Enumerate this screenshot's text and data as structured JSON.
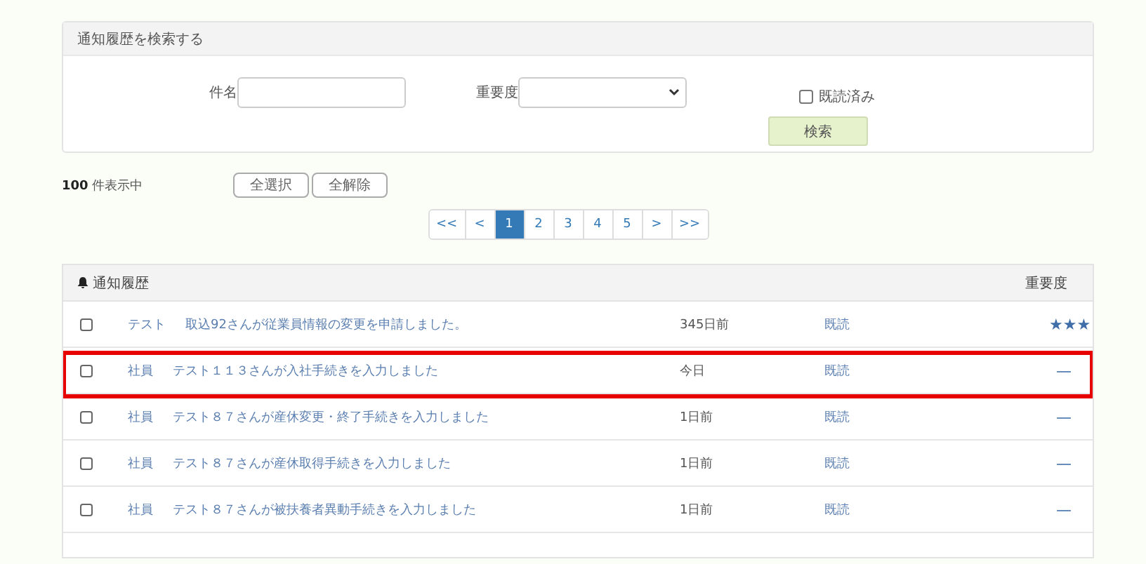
{
  "search_panel": {
    "title": "通知履歴を検索する",
    "subject_label": "件名",
    "importance_label": "重要度",
    "read_checkbox": {
      "label": "既読済み",
      "checked": false
    },
    "search_button": "検索"
  },
  "summary": {
    "count": "100",
    "suffix": "件表示中",
    "buttons": [
      "全選択",
      "全解除"
    ]
  },
  "pagination": [
    {
      "label": "<<",
      "selected": false
    },
    {
      "label": "<",
      "selected": false
    },
    {
      "label": "1",
      "selected": true
    },
    {
      "label": "2",
      "selected": false
    },
    {
      "label": "3",
      "selected": false
    },
    {
      "label": "4",
      "selected": false
    },
    {
      "label": "5",
      "selected": false
    },
    {
      "label": ">",
      "selected": false
    },
    {
      "label": ">>",
      "selected": false
    }
  ],
  "notifications": {
    "title": "通知履歴",
    "importance_header": "重要度",
    "rows": [
      {
        "checked": false,
        "highlighted": false,
        "category": "テスト",
        "message": "取込92さんが従業員情報の変更を申請しました。",
        "time": "345日前",
        "status": "既読",
        "importance": "★★★"
      },
      {
        "checked": false,
        "highlighted": true,
        "category": "社員",
        "message": "テスト１１３さんが入社手続きを入力しました",
        "time": "今日",
        "status": "既読",
        "importance": "—"
      },
      {
        "checked": false,
        "highlighted": false,
        "category": "社員",
        "message": "テスト８７さんが産休変更・終了手続きを入力しました",
        "time": "1日前",
        "status": "既読",
        "importance": "—"
      },
      {
        "checked": false,
        "highlighted": false,
        "category": "社員",
        "message": "テスト８７さんが産休取得手続きを入力しました",
        "time": "1日前",
        "status": "既読",
        "importance": "—"
      },
      {
        "checked": false,
        "highlighted": false,
        "category": "社員",
        "message": "テスト８７さんが被扶養者異動手続きを入力しました",
        "time": "1日前",
        "status": "既読",
        "importance": "—"
      }
    ]
  }
}
